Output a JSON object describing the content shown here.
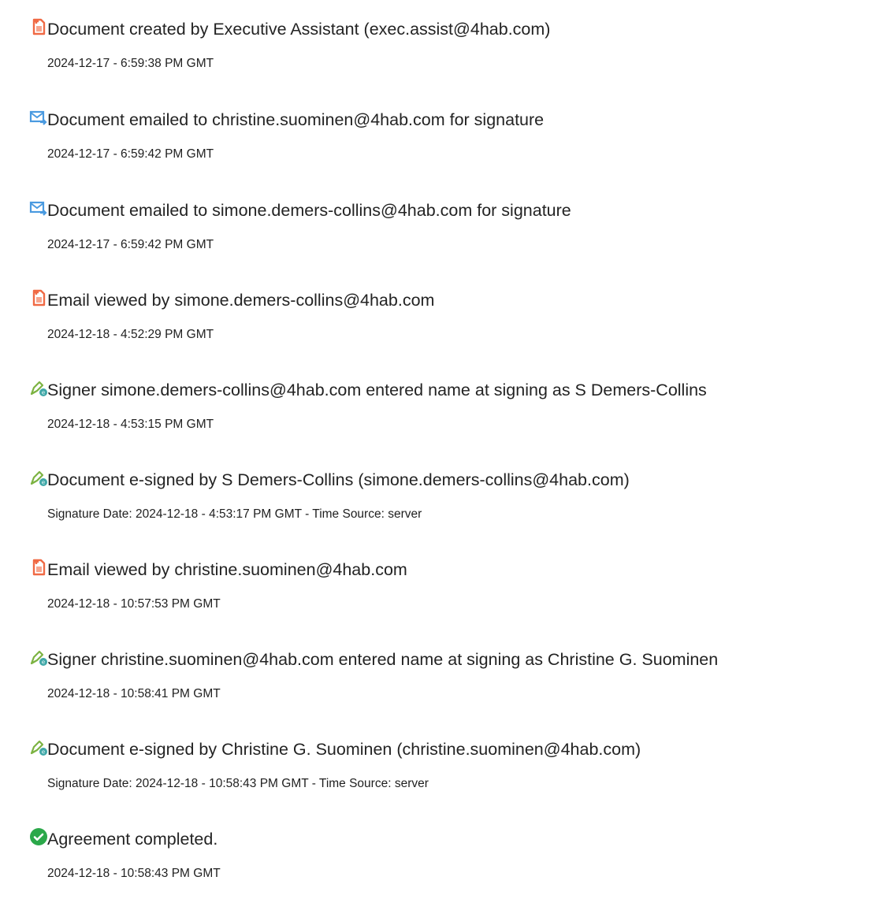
{
  "colors": {
    "doc_icon": "#f06a45",
    "email_icon": "#4a9ae0",
    "sign_icon_pen": "#7cb342",
    "sign_icon_badge": "#3fa7a7",
    "complete_icon": "#2ba84a",
    "text": "#232323"
  },
  "events": [
    {
      "icon": "document-icon",
      "title": "Document created by Executive Assistant (exec.assist@4hab.com)",
      "subtitle": "2024-12-17 - 6:59:38 PM GMT"
    },
    {
      "icon": "email-icon",
      "title": "Document emailed to christine.suominen@4hab.com for signature",
      "subtitle": "2024-12-17 - 6:59:42 PM GMT"
    },
    {
      "icon": "email-icon",
      "title": "Document emailed to simone.demers-collins@4hab.com for signature",
      "subtitle": "2024-12-17 - 6:59:42 PM GMT"
    },
    {
      "icon": "document-icon",
      "title": "Email viewed by simone.demers-collins@4hab.com",
      "subtitle": "2024-12-18 - 4:52:29 PM GMT"
    },
    {
      "icon": "e-sign-icon",
      "title": "Signer simone.demers-collins@4hab.com entered name at signing as S Demers-Collins",
      "subtitle": "2024-12-18 - 4:53:15 PM GMT"
    },
    {
      "icon": "e-sign-icon",
      "title": "Document e-signed by S Demers-Collins (simone.demers-collins@4hab.com)",
      "subtitle": "Signature Date: 2024-12-18 - 4:53:17 PM GMT - Time Source: server"
    },
    {
      "icon": "document-icon",
      "title": "Email viewed by christine.suominen@4hab.com",
      "subtitle": "2024-12-18 - 10:57:53 PM GMT"
    },
    {
      "icon": "e-sign-icon",
      "title": "Signer christine.suominen@4hab.com entered name at signing as Christine G. Suominen",
      "subtitle": "2024-12-18 - 10:58:41 PM GMT"
    },
    {
      "icon": "e-sign-icon",
      "title": "Document e-signed by Christine G. Suominen (christine.suominen@4hab.com)",
      "subtitle": "Signature Date: 2024-12-18 - 10:58:43 PM GMT - Time Source: server"
    },
    {
      "icon": "check-circle-icon",
      "title": "Agreement completed.",
      "subtitle": "2024-12-18 - 10:58:43 PM GMT"
    }
  ]
}
